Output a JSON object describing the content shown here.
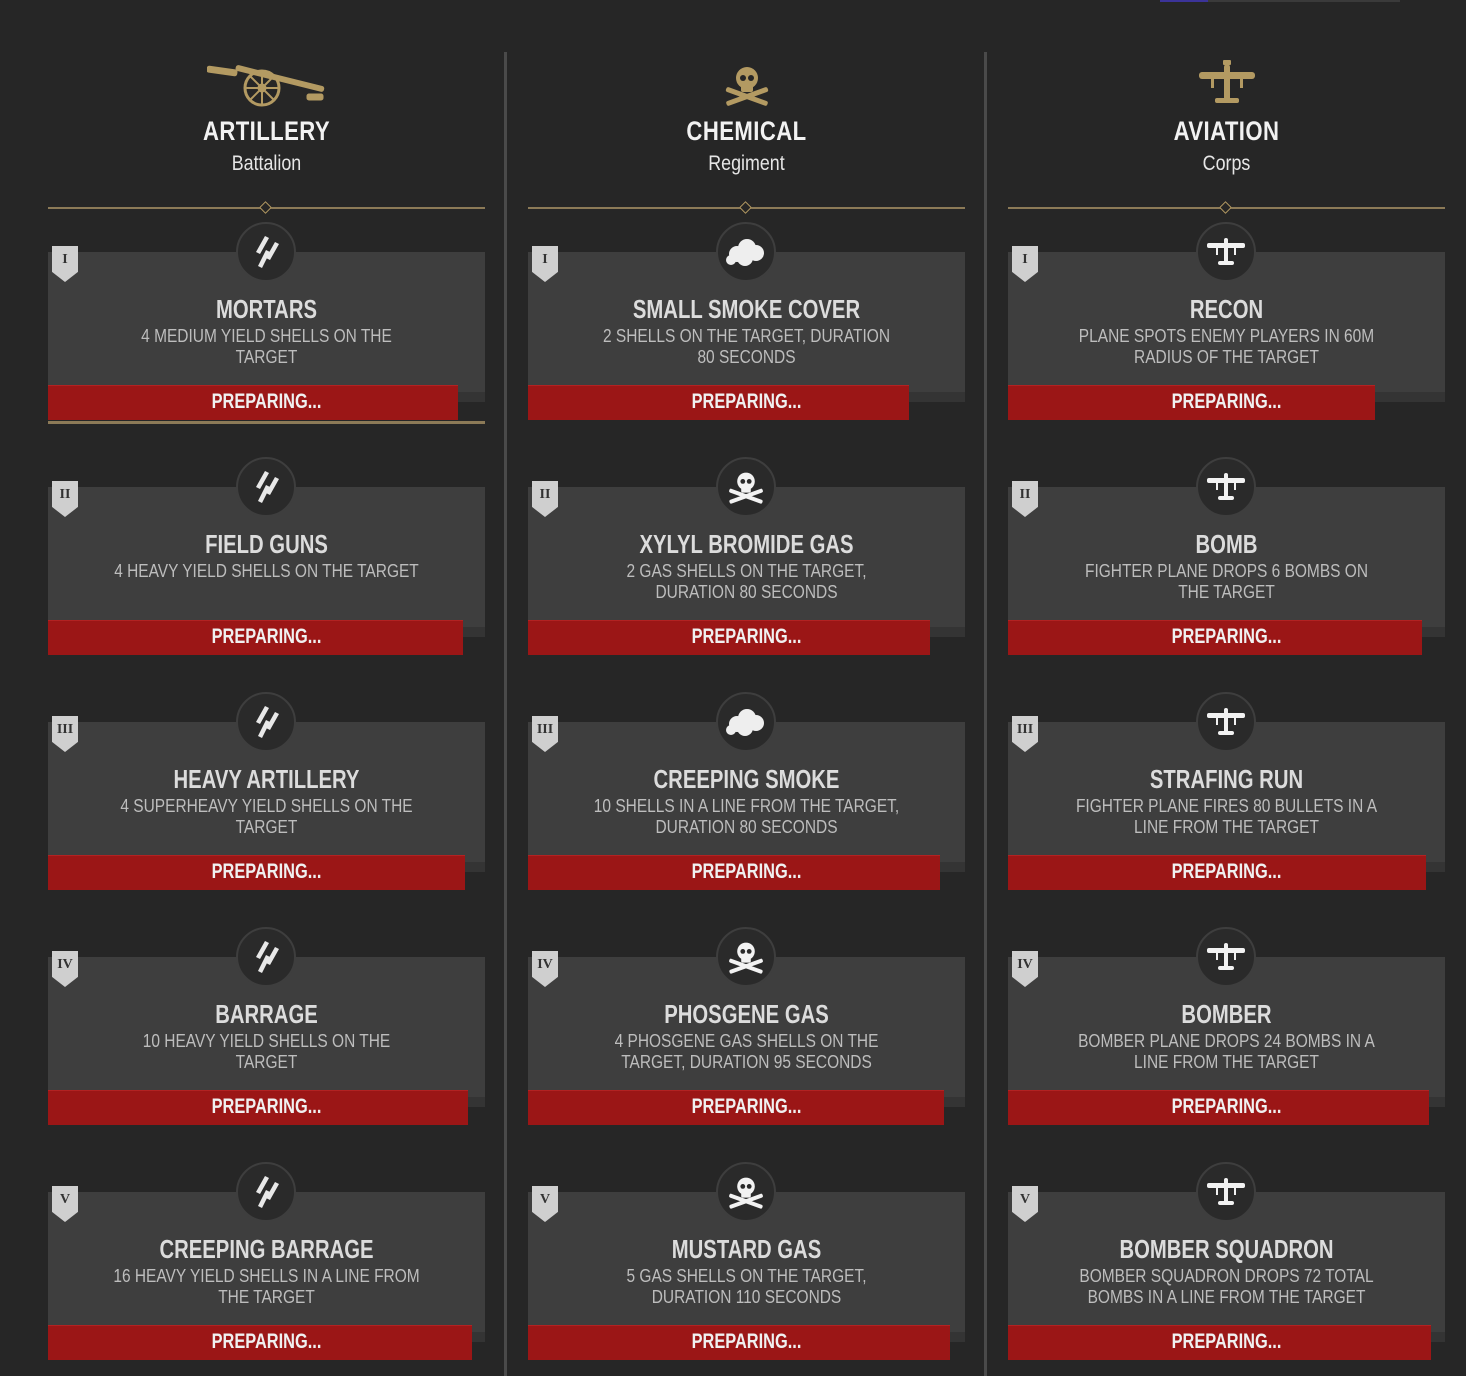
{
  "status_label": "PREPARING...",
  "colors": {
    "accent_gold": "#b39a62",
    "progress_red": "#9b1616",
    "card_bg": "#3e3e3e"
  },
  "columns": [
    {
      "title": "ARTILLERY",
      "subtitle": "Battalion",
      "header_icon": "cannon-icon",
      "ability_icon": "shells-icon",
      "abilities": [
        {
          "tier": "I",
          "name": "MORTARS",
          "desc": "4 MEDIUM YIELD SHELLS ON THE TARGET",
          "progress": 0.938,
          "icon": "shells-icon"
        },
        {
          "tier": "II",
          "name": "FIELD GUNS",
          "desc": "4 HEAVY YIELD SHELLS ON THE TARGET",
          "progress": 0.95,
          "icon": "shells-icon"
        },
        {
          "tier": "III",
          "name": "HEAVY ARTILLERY",
          "desc": "4 SUPERHEAVY YIELD SHELLS ON THE TARGET",
          "progress": 0.954,
          "icon": "shells-icon"
        },
        {
          "tier": "IV",
          "name": "BARRAGE",
          "desc": "10 HEAVY YIELD SHELLS ON THE TARGET",
          "progress": 0.961,
          "icon": "shells-icon"
        },
        {
          "tier": "V",
          "name": "CREEPING BARRAGE",
          "desc": "16 HEAVY YIELD SHELLS IN A LINE FROM THE TARGET",
          "progress": 0.97,
          "icon": "shells-icon"
        }
      ]
    },
    {
      "title": "CHEMICAL",
      "subtitle": "Regiment",
      "header_icon": "skull-crossbones-icon",
      "abilities": [
        {
          "tier": "I",
          "name": "SMALL SMOKE COVER",
          "desc": "2 SHELLS ON THE TARGET, DURATION 80 SECONDS",
          "progress": 0.872,
          "icon": "smoke-cloud-icon"
        },
        {
          "tier": "II",
          "name": "XYLYL BROMIDE GAS",
          "desc": "2 GAS SHELLS ON THE TARGET, DURATION 80 SECONDS",
          "progress": 0.92,
          "icon": "skull-crossbones-icon"
        },
        {
          "tier": "III",
          "name": "CREEPING SMOKE",
          "desc": "10 SHELLS IN A LINE FROM THE TARGET, DURATION 80 SECONDS",
          "progress": 0.943,
          "icon": "smoke-cloud-icon"
        },
        {
          "tier": "IV",
          "name": "PHOSGENE GAS",
          "desc": "4 PHOSGENE GAS SHELLS ON THE TARGET, DURATION 95 SECONDS",
          "progress": 0.952,
          "icon": "skull-crossbones-icon"
        },
        {
          "tier": "V",
          "name": "MUSTARD GAS",
          "desc": "5 GAS SHELLS ON THE TARGET, DURATION 110 SECONDS",
          "progress": 0.966,
          "icon": "skull-crossbones-icon"
        }
      ]
    },
    {
      "title": "AVIATION",
      "subtitle": "Corps",
      "header_icon": "biplane-icon",
      "abilities": [
        {
          "tier": "I",
          "name": "RECON",
          "desc": "PLANE SPOTS ENEMY PLAYERS IN 60M RADIUS OF THE TARGET",
          "progress": 0.84,
          "icon": "plane-icon"
        },
        {
          "tier": "II",
          "name": "BOMB",
          "desc": "FIGHTER PLANE DROPS 6 BOMBS ON THE TARGET",
          "progress": 0.947,
          "icon": "plane-icon"
        },
        {
          "tier": "III",
          "name": "STRAFING RUN",
          "desc": "FIGHTER PLANE FIRES 80 BULLETS IN A LINE FROM THE TARGET",
          "progress": 0.956,
          "icon": "plane-icon"
        },
        {
          "tier": "IV",
          "name": "BOMBER",
          "desc": "BOMBER PLANE DROPS 24 BOMBS IN A LINE FROM THE TARGET",
          "progress": 0.963,
          "icon": "plane-icon"
        },
        {
          "tier": "V",
          "name": "BOMBER SQUADRON",
          "desc": "BOMBER SQUADRON DROPS 72 TOTAL BOMBS IN A LINE FROM THE TARGET",
          "progress": 0.968,
          "icon": "plane-icon"
        }
      ]
    }
  ]
}
